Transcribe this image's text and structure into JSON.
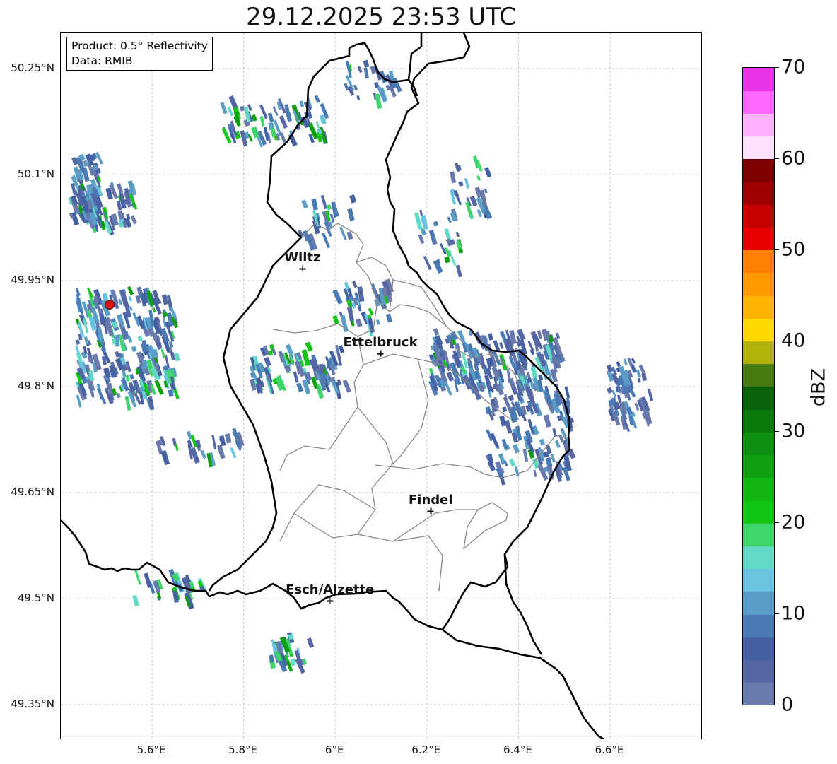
{
  "title": "29.12.2025 23:53 UTC",
  "info": {
    "product": "Product: 0.5° Reflectivity",
    "data": "Data: RMIB"
  },
  "lat_labels": [
    {
      "value": 50.25,
      "label": "50.25°N"
    },
    {
      "value": 50.1,
      "label": "50.1°N"
    },
    {
      "value": 49.95,
      "label": "49.95°N"
    },
    {
      "value": 49.8,
      "label": "49.8°N"
    },
    {
      "value": 49.65,
      "label": "49.65°N"
    },
    {
      "value": 49.5,
      "label": "49.5°N"
    },
    {
      "value": 49.35,
      "label": "49.35°N"
    }
  ],
  "lon_labels": [
    {
      "value": 5.6,
      "label": "5.6°E"
    },
    {
      "value": 5.8,
      "label": "5.8°E"
    },
    {
      "value": 6.0,
      "label": "6°E"
    },
    {
      "value": 6.2,
      "label": "6.2°E"
    },
    {
      "value": 6.4,
      "label": "6.4°E"
    },
    {
      "value": 6.6,
      "label": "6.6°E"
    }
  ],
  "cities": [
    {
      "name": "Wiltz",
      "lon": 5.93,
      "lat": 49.966
    },
    {
      "name": "Ettelbruck",
      "lon": 6.1,
      "lat": 49.846
    },
    {
      "name": "Findel",
      "lon": 6.21,
      "lat": 49.623
    },
    {
      "name": "Esch/Alzette",
      "lon": 5.99,
      "lat": 49.496
    }
  ],
  "radar_site_label": "radar-site",
  "colorbar": {
    "unit": "dBZ",
    "min": 0,
    "max": 70,
    "ticks": [
      "0",
      "10",
      "20",
      "30",
      "40",
      "50",
      "60",
      "70"
    ],
    "colors": [
      "#6a7aad",
      "#5466a3",
      "#4560a3",
      "#4a7ab3",
      "#5a9ec8",
      "#68c4e0",
      "#62d9c4",
      "#3ed66a",
      "#14c614",
      "#11b611",
      "#109f10",
      "#0f8f0f",
      "#0c7a0c",
      "#0a620a",
      "#477a10",
      "#b2b20a",
      "#ffd800",
      "#ffb400",
      "#ff9900",
      "#ff7f00",
      "#e60000",
      "#c80000",
      "#a00000",
      "#7d0000",
      "#ffe0ff",
      "#ffb0ff",
      "#ff66ff",
      "#e833e8"
    ]
  }
}
